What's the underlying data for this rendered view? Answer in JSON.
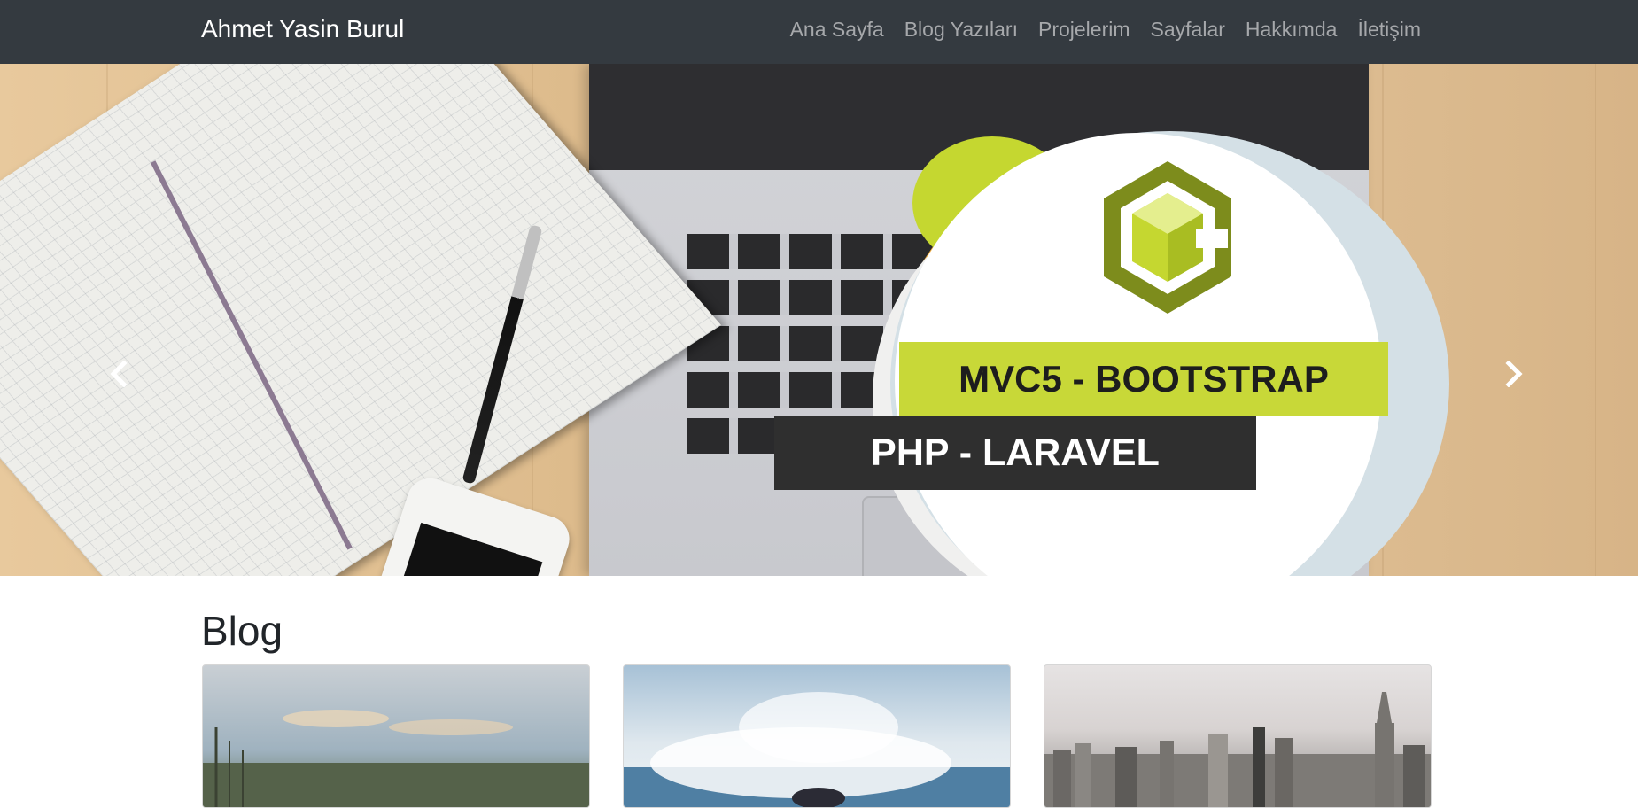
{
  "navbar": {
    "brand": "Ahmet Yasin Burul",
    "links": [
      "Ana Sayfa",
      "Blog Yazıları",
      "Projelerim",
      "Sayfalar",
      "Hakkımda",
      "İletişim"
    ]
  },
  "hero": {
    "banner_top": "MVC5 - BOOTSTRAP",
    "banner_bottom": "PHP - LARAVEL",
    "prev_icon": "chevron-left-icon",
    "next_icon": "chevron-right-icon"
  },
  "blog": {
    "heading": "Blog",
    "cards": [
      {
        "image": "landscape-sky-trees-photo"
      },
      {
        "image": "ocean-wave-splash-photo"
      },
      {
        "image": "city-skyline-photo"
      }
    ]
  },
  "colors": {
    "navbar_bg": "#343a40",
    "lime": "#c8d838",
    "dark_banner": "#2f2f2f",
    "orange": "#f6b13f",
    "logo_green": "#7d8c1c"
  }
}
